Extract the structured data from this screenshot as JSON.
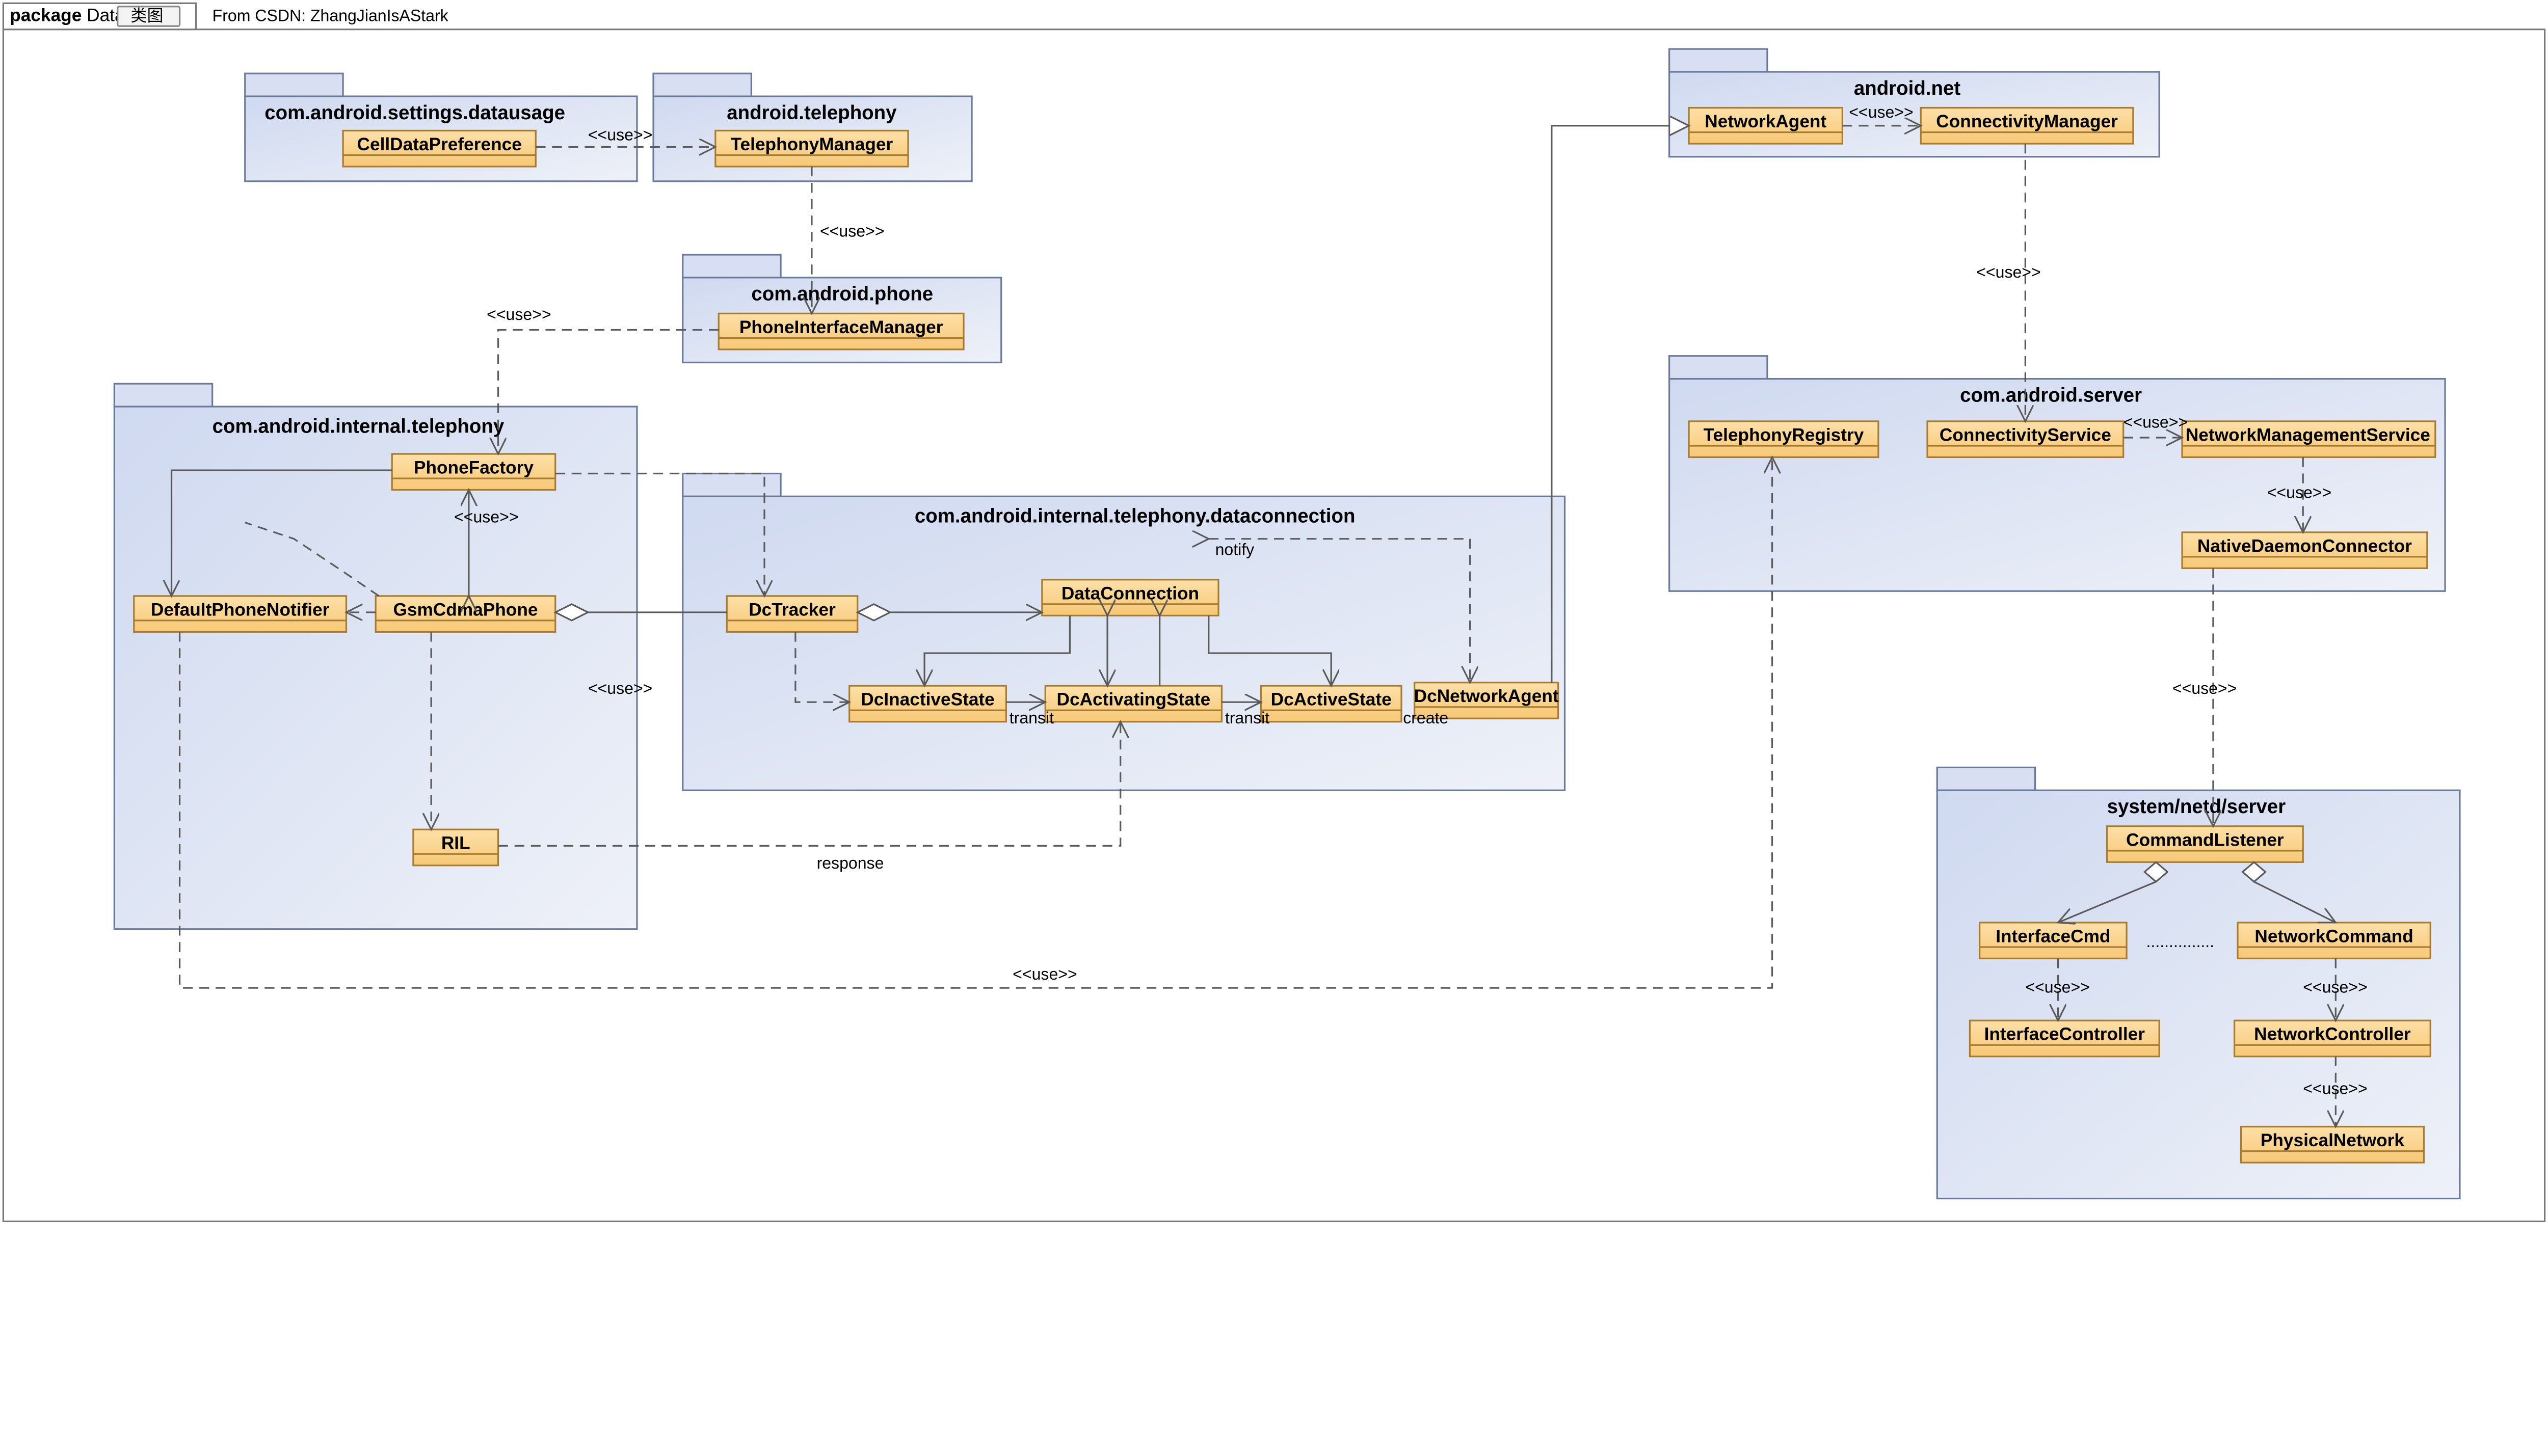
{
  "header": {
    "package_label": "package",
    "package_name": "Data",
    "tab_label": "类图",
    "from_label": "From CSDN: ZhangJianIsAStark"
  },
  "packages": {
    "p_settings": {
      "title": "com.android.settings.datausage"
    },
    "p_telephony": {
      "title": "android.telephony"
    },
    "p_phone": {
      "title": "com.android.phone"
    },
    "p_internal": {
      "title": "com.android.internal.telephony"
    },
    "p_dataconn": {
      "title": "com.android.internal.telephony.dataconnection"
    },
    "p_net": {
      "title": "android.net"
    },
    "p_server": {
      "title": "com.android.server"
    },
    "p_netd": {
      "title": "system/netd/server"
    }
  },
  "classes": {
    "CellDataPreference": {
      "name": "CellDataPreference"
    },
    "TelephonyManager": {
      "name": "TelephonyManager"
    },
    "PhoneInterfaceManager": {
      "name": "PhoneInterfaceManager"
    },
    "PhoneFactory": {
      "name": "PhoneFactory"
    },
    "GsmCdmaPhone": {
      "name": "GsmCdmaPhone"
    },
    "DefaultPhoneNotifier": {
      "name": "DefaultPhoneNotifier"
    },
    "RIL": {
      "name": "RIL"
    },
    "DcTracker": {
      "name": "DcTracker"
    },
    "DataConnection": {
      "name": "DataConnection"
    },
    "DcInactiveState": {
      "name": "DcInactiveState"
    },
    "DcActivatingState": {
      "name": "DcActivatingState"
    },
    "DcActiveState": {
      "name": "DcActiveState"
    },
    "DcNetworkAgent": {
      "name": "DcNetworkAgent"
    },
    "NetworkAgent": {
      "name": "NetworkAgent"
    },
    "ConnectivityManager": {
      "name": "ConnectivityManager"
    },
    "TelephonyRegistry": {
      "name": "TelephonyRegistry"
    },
    "ConnectivityService": {
      "name": "ConnectivityService"
    },
    "NetworkManagementService": {
      "name": "NetworkManagementService"
    },
    "NativeDaemonConnector": {
      "name": "NativeDaemonConnector"
    },
    "CommandListener": {
      "name": "CommandListener"
    },
    "InterfaceCmd": {
      "name": "InterfaceCmd"
    },
    "NetworkCommand": {
      "name": "NetworkCommand"
    },
    "InterfaceController": {
      "name": "InterfaceController"
    },
    "NetworkController": {
      "name": "NetworkController"
    },
    "PhysicalNetwork": {
      "name": "PhysicalNetwork"
    }
  },
  "labels": {
    "use": "<<use>>",
    "transit": "transit",
    "create": "create",
    "response": "response",
    "notify": "notify",
    "dots": "..............."
  }
}
